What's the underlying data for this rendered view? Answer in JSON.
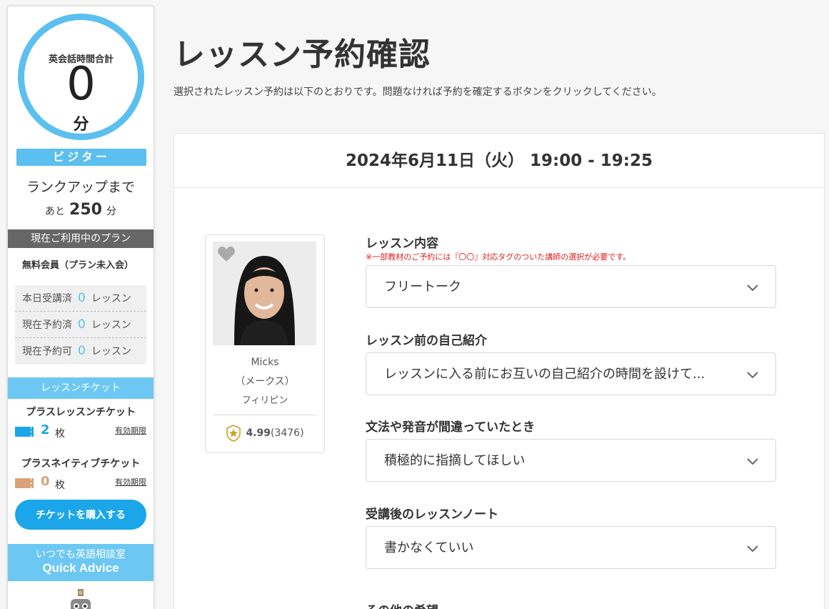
{
  "sidebar": {
    "total_label": "英会話時間合計",
    "total_value": "0",
    "total_unit": "分",
    "rank": "ビジター",
    "rankup_label": "ランクアップまで",
    "remain_prefix": "あと",
    "remain_value": "250",
    "remain_unit": "分",
    "plan_header": "現在ご利用中のプラン",
    "plan_name": "無料会員（プラン未入会）",
    "stats": [
      {
        "label": "本日受講済",
        "value": "0",
        "unit": "レッスン"
      },
      {
        "label": "現在予約済",
        "value": "0",
        "unit": "レッスン"
      },
      {
        "label": "現在予約可",
        "value": "0",
        "unit": "レッスン"
      }
    ],
    "ticket_header": "レッスンチケット",
    "tickets": [
      {
        "name": "プラスレッスンチケット",
        "count": "2",
        "unit": "枚",
        "expiry": "有効期限",
        "color": "#1aa6e8"
      },
      {
        "name": "プラスネイティブチケット",
        "count": "0",
        "unit": "枚",
        "expiry": "有効期限",
        "color": "#d9a27b"
      }
    ],
    "buy_button": "チケットを購入する",
    "quick_advice_line1": "いつでも英語相談室",
    "quick_advice_line2": "Quick Advice"
  },
  "main": {
    "title": "レッスン予約確認",
    "description": "選択されたレッスン予約は以下のとおりです。問題なければ予約を確定するボタンをクリックしてください。",
    "datetime": "2024年6月11日（火） 19:00 - 19:25",
    "teacher": {
      "name": "Micks",
      "kana": "（メークス）",
      "country": "フィリピン",
      "rating": "4.99",
      "reviews": "(3476)"
    },
    "form": [
      {
        "label": "レッスン内容",
        "note": "※一部教材のご予約には『〇〇』対応タグのついた講師の選択が必要です。",
        "value": "フリートーク"
      },
      {
        "label": "レッスン前の自己紹介",
        "note": "",
        "value": "レッスンに入る前にお互いの自己紹介の時間を設けて..."
      },
      {
        "label": "文法や発音が間違っていたとき",
        "note": "",
        "value": "積極的に指摘してほしい"
      },
      {
        "label": "受講後のレッスンノート",
        "note": "",
        "value": "書かなくていい"
      }
    ],
    "next_label": "その他の希望"
  },
  "colors": {
    "accent": "#5bbfef",
    "primary_button": "#1aa6e8",
    "note_red": "#e02020"
  }
}
